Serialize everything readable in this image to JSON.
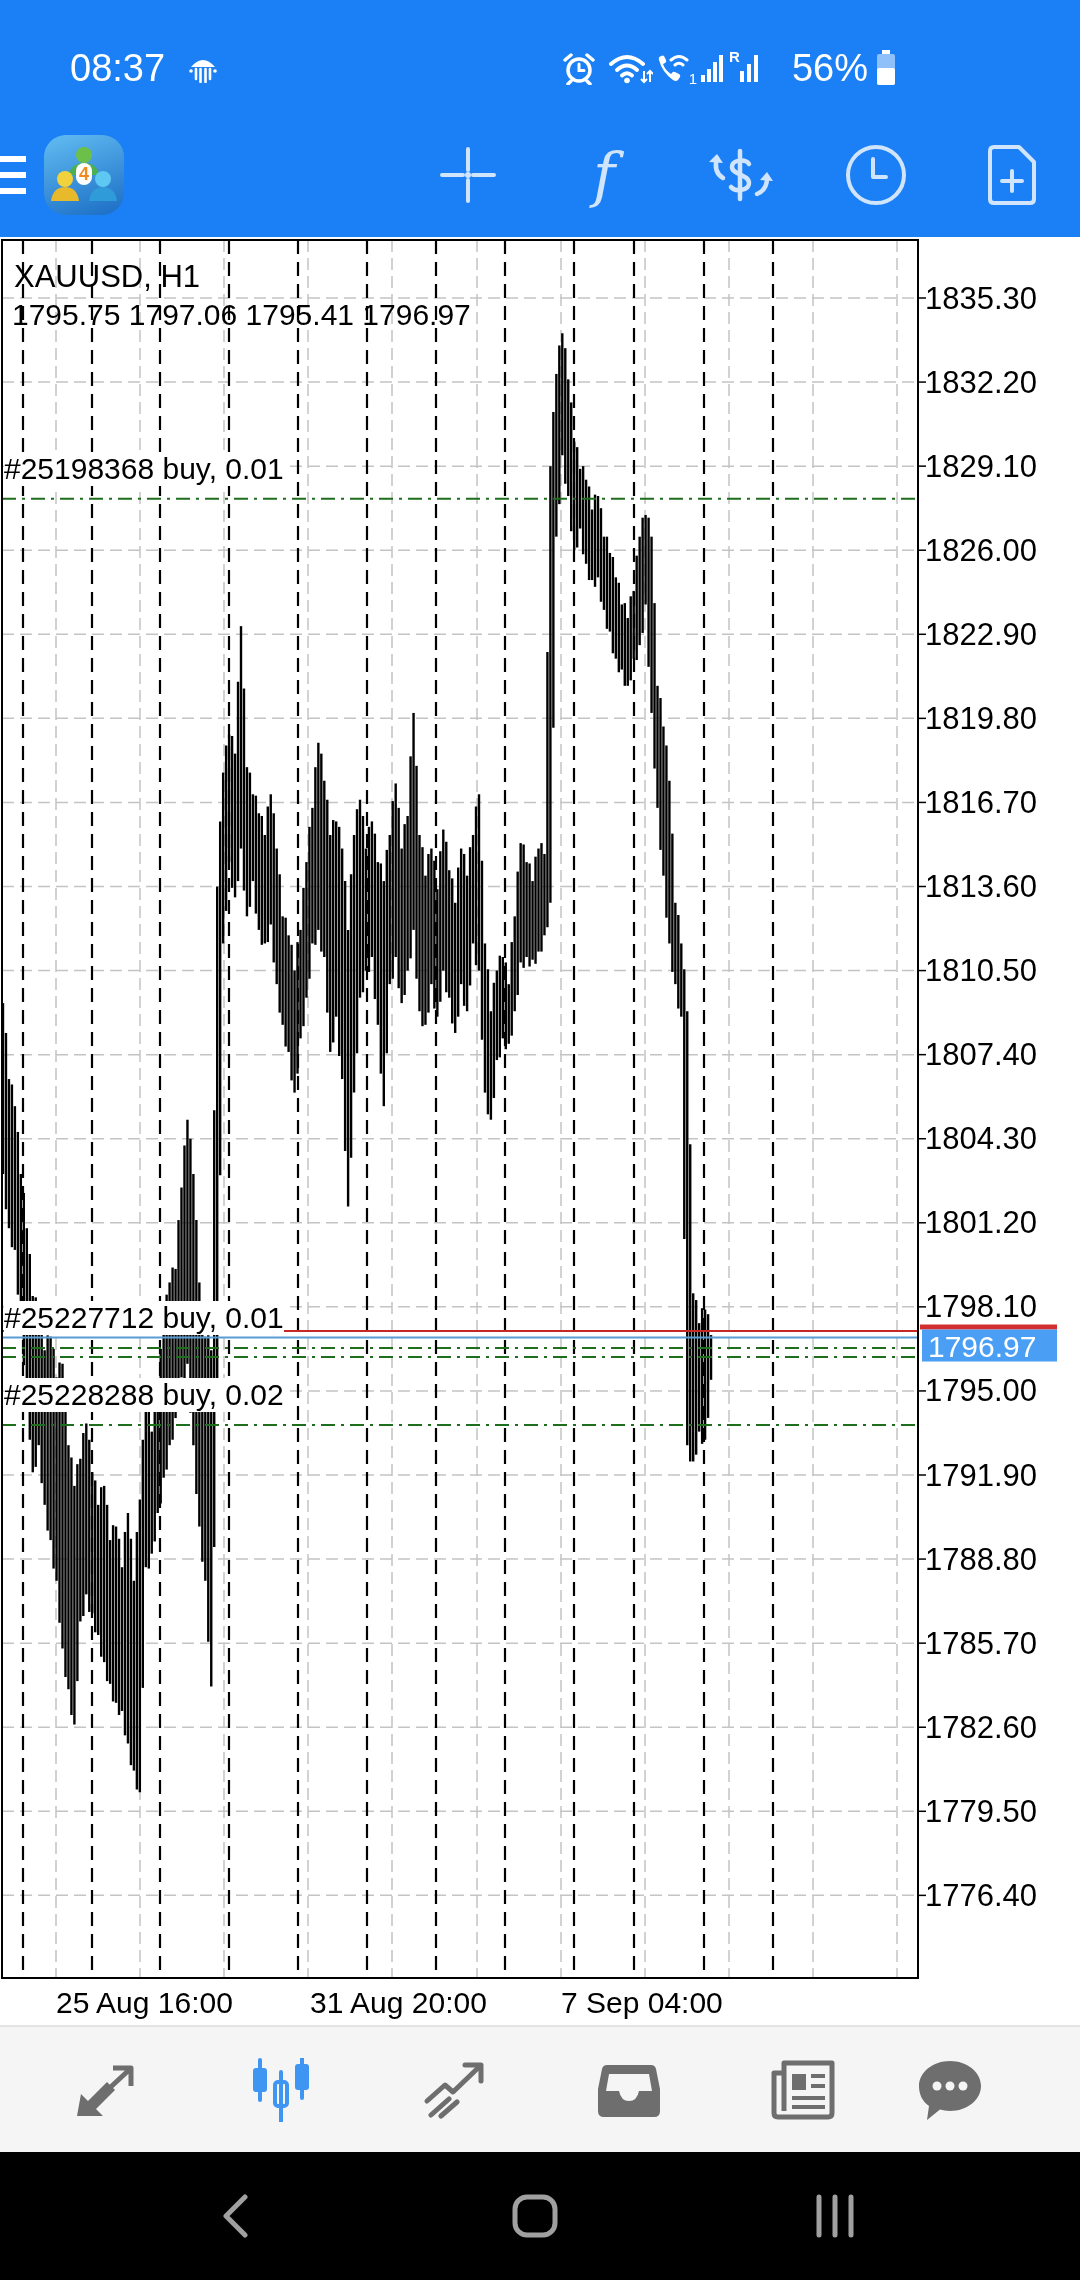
{
  "status_bar": {
    "time": "08:37",
    "wifi_call_sim": "1",
    "roaming_mark": "R",
    "battery": "56%"
  },
  "toolbar": {
    "logo_badge": "4",
    "function_glyph": "f"
  },
  "chart": {
    "title": "XAUUSD, H1",
    "quote": "1795.75 1797.06 1795.41 1796.97",
    "orders": [
      {
        "label": "#25198368 buy, 0.01"
      },
      {
        "label": "#25227712 buy, 0.01"
      },
      {
        "label": "#25228288 buy, 0.02"
      }
    ],
    "bid_price": "1796.97",
    "price_scale": [
      "1835.30",
      "1832.20",
      "1829.10",
      "1826.00",
      "1822.90",
      "1819.80",
      "1816.70",
      "1813.60",
      "1810.50",
      "1807.40",
      "1804.30",
      "1801.20",
      "1798.10",
      "1795.00",
      "1791.90",
      "1788.80",
      "1785.70",
      "1782.60",
      "1779.50",
      "1776.40"
    ],
    "time_scale": [
      "25 Aug 16:00",
      "31 Aug 20:00",
      "7 Sep 04:00"
    ]
  },
  "bottom_tabs": [
    {
      "kind": "quotes",
      "selected": false
    },
    {
      "kind": "chart",
      "selected": true
    },
    {
      "kind": "trade",
      "selected": false
    },
    {
      "kind": "history",
      "selected": false
    },
    {
      "kind": "news",
      "selected": false
    },
    {
      "kind": "messages",
      "selected": false
    }
  ]
}
